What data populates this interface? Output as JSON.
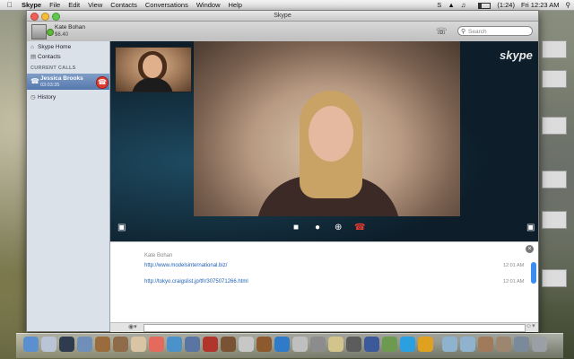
{
  "menubar": {
    "app": "Skype",
    "items": [
      "File",
      "Edit",
      "View",
      "Contacts",
      "Conversations",
      "Window",
      "Help"
    ],
    "clock": "Fri 12:23 AM",
    "battery": "(1:24)"
  },
  "window": {
    "title": "Skype"
  },
  "account": {
    "name": "Kate Bohan",
    "credit": "$6.40"
  },
  "search": {
    "placeholder": "Search"
  },
  "sidebar": {
    "home": "Skype Home",
    "contacts": "Contacts",
    "section_current_calls": "CURRENT CALLS",
    "call": {
      "name": "Jessica Brooks",
      "time": "03:03:35"
    },
    "history": "History"
  },
  "video": {
    "logo": "skype"
  },
  "chat": {
    "sender": "Kate Bohan",
    "messages": [
      {
        "text": "http://www.modelsinternational.biz/",
        "time": "12:01 AM"
      },
      {
        "text": "http://tokyo.craigslist.jp/tfr/3075071266.html",
        "time": "12:01 AM"
      }
    ]
  },
  "desktop_icons": [
    "...PC",
    "...n shot\n...23 AM",
    "...ion shot\n...ng 2.19",
    "...ion shot\n...2:01 AM"
  ],
  "colors": {
    "hangup": "#e03a2e",
    "online": "#5fb83a",
    "link": "#1f5fb5",
    "selection": "#5578ad"
  }
}
